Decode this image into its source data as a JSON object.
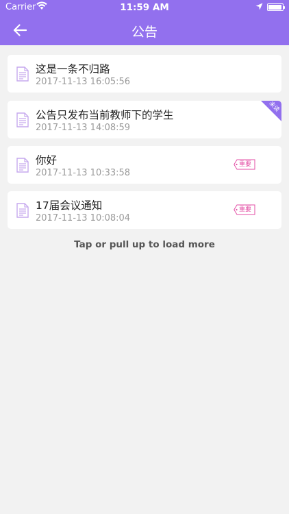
{
  "status_bar": {
    "carrier": "Carrier",
    "time": "11:59 AM",
    "battery_level": 0.95
  },
  "nav": {
    "title": "公告",
    "back_icon": "arrow-left-icon"
  },
  "colors": {
    "header_bg": "#9270ee",
    "tag_pink": "#e34ea5",
    "unread_purple": "#9270ee",
    "doc_icon": "#c6a9ee"
  },
  "announcements": [
    {
      "title": "这是一条不归路",
      "date": "2017-11-13 16:05:56",
      "important_label": "",
      "unread_label": ""
    },
    {
      "title": "公告只发布当前教师下的学生",
      "date": "2017-11-13 14:08:59",
      "important_label": "",
      "unread_label": "未读"
    },
    {
      "title": "你好",
      "date": "2017-11-13 10:33:58",
      "important_label": "重要",
      "unread_label": ""
    },
    {
      "title": "17届会议通知",
      "date": "2017-11-13 10:08:04",
      "important_label": "重要",
      "unread_label": ""
    }
  ],
  "load_more": "Tap or pull up to load more"
}
